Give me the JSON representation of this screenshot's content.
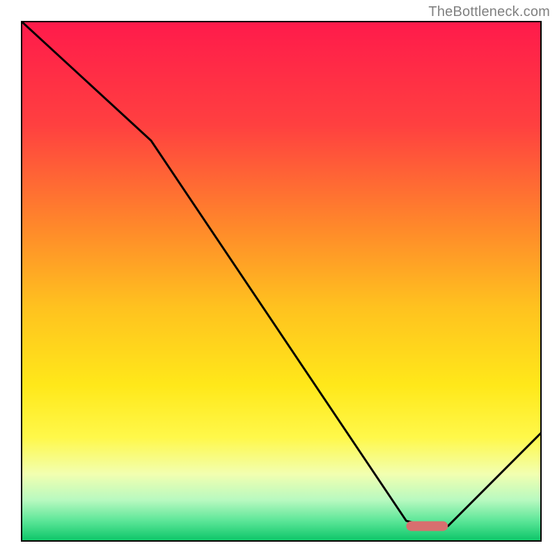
{
  "attribution": "TheBottleneck.com",
  "chart_data": {
    "type": "line",
    "title": "",
    "xlabel": "",
    "ylabel": "",
    "xlim": [
      0,
      100
    ],
    "ylim": [
      0,
      100
    ],
    "grid": false,
    "series": [
      {
        "name": "curve",
        "x": [
          0,
          25,
          74,
          78,
          82,
          100
        ],
        "values": [
          100,
          77,
          4,
          3,
          3,
          21
        ]
      }
    ],
    "marker": {
      "x_start": 74,
      "x_end": 82,
      "y": 3,
      "color": "#d86f6f"
    },
    "background_gradient": {
      "stops": [
        {
          "offset": 0.0,
          "color": "#ff1a4b"
        },
        {
          "offset": 0.2,
          "color": "#ff4040"
        },
        {
          "offset": 0.4,
          "color": "#ff8a2a"
        },
        {
          "offset": 0.55,
          "color": "#ffc21f"
        },
        {
          "offset": 0.7,
          "color": "#ffe81a"
        },
        {
          "offset": 0.8,
          "color": "#fff84a"
        },
        {
          "offset": 0.87,
          "color": "#f2ffb0"
        },
        {
          "offset": 0.92,
          "color": "#b8f9c0"
        },
        {
          "offset": 0.96,
          "color": "#5ce698"
        },
        {
          "offset": 1.0,
          "color": "#08c466"
        }
      ]
    },
    "line_color": "#000000",
    "line_width": 3
  }
}
